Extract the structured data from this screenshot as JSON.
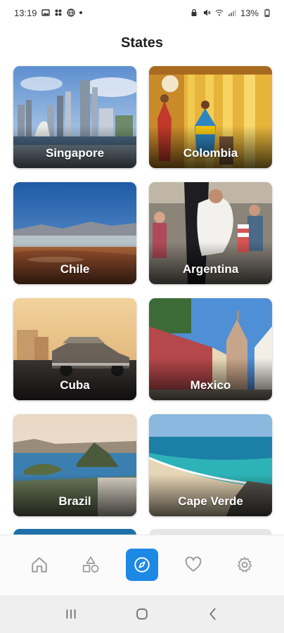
{
  "status_bar": {
    "time": "13:19",
    "battery": "13%"
  },
  "header": {
    "title": "States"
  },
  "cards": [
    {
      "name": "Singapore"
    },
    {
      "name": "Colombia"
    },
    {
      "name": "Chile"
    },
    {
      "name": "Argentina"
    },
    {
      "name": "Cuba"
    },
    {
      "name": "Mexico"
    },
    {
      "name": "Brazil"
    },
    {
      "name": "Cape Verde"
    }
  ],
  "bottom_nav": {
    "items": [
      {
        "icon": "home-icon"
      },
      {
        "icon": "shapes-icon"
      },
      {
        "icon": "compass-icon",
        "active": true
      },
      {
        "icon": "heart-icon"
      },
      {
        "icon": "gear-icon"
      }
    ],
    "accent_color": "#1e88e5"
  },
  "system_nav": {
    "items": [
      {
        "icon": "recents-icon"
      },
      {
        "icon": "home-circle-icon"
      },
      {
        "icon": "back-icon"
      }
    ]
  }
}
